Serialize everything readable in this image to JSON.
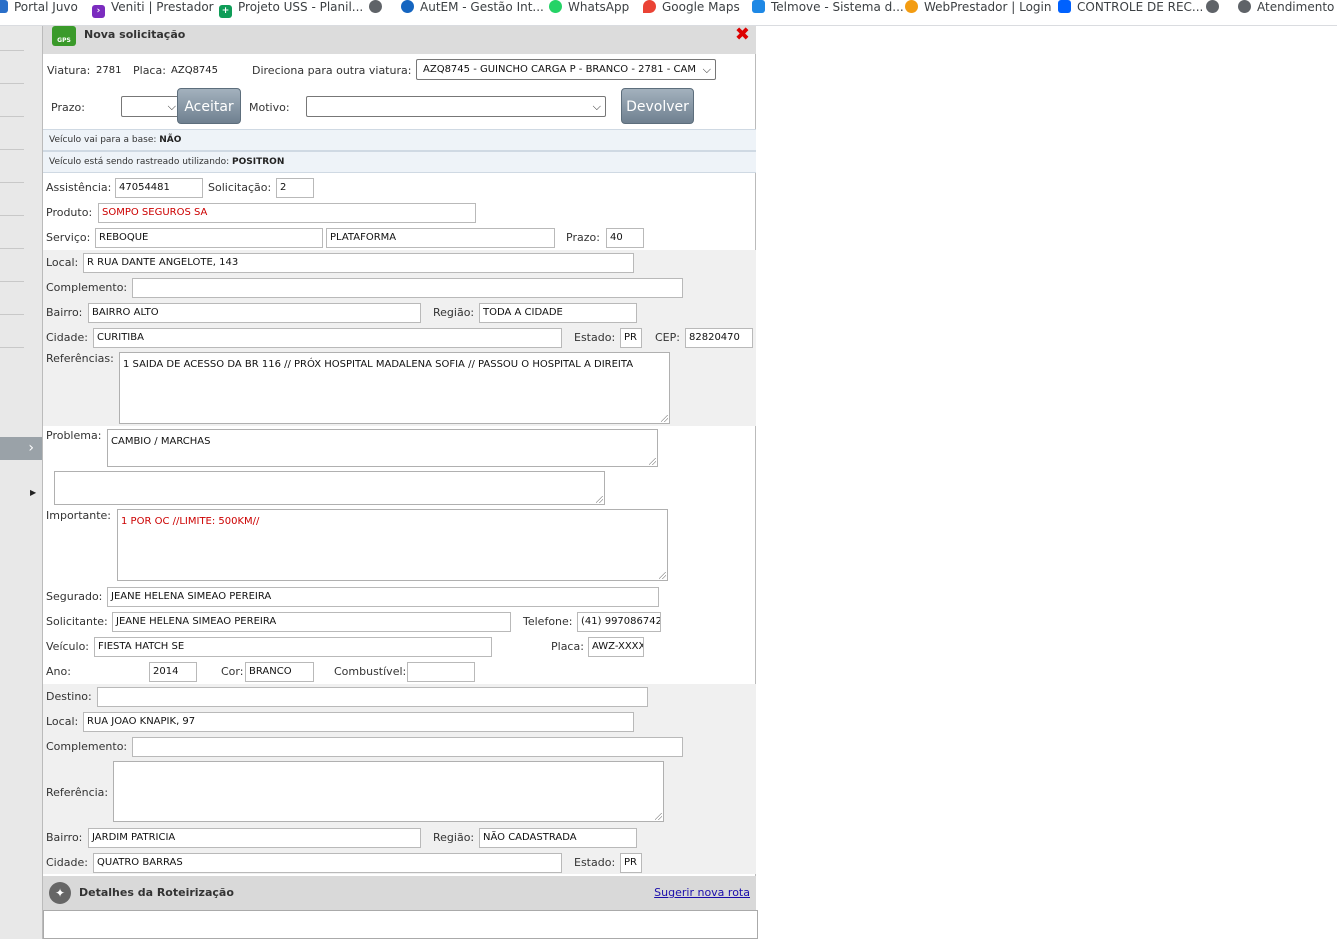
{
  "bookmarks": [
    {
      "label": "Portal Juvo",
      "icon": "portal-icon"
    },
    {
      "label": "Veniti | Prestador",
      "icon": "veniti-icon"
    },
    {
      "label": "Projeto USS - Planil...",
      "icon": "sheets-icon"
    },
    {
      "label": "",
      "icon": "globe-icon"
    },
    {
      "label": "AutEM - Gestão Int...",
      "icon": "autem-icon"
    },
    {
      "label": "WhatsApp",
      "icon": "whatsapp-icon"
    },
    {
      "label": "Google Maps",
      "icon": "maps-icon"
    },
    {
      "label": "Telmove - Sistema d...",
      "icon": "telmove-icon"
    },
    {
      "label": "WebPrestador | Login",
      "icon": "webprestador-icon"
    },
    {
      "label": "CONTROLE DE REC...",
      "icon": "dropbox-icon"
    },
    {
      "label": "",
      "icon": "globe-icon"
    },
    {
      "label": "Atendimento",
      "icon": "globe-icon"
    }
  ],
  "dialog": {
    "title": "Nova solicitação",
    "gps_badge": "GPS",
    "close_glyph": "✖",
    "viatura_label": "Viatura:",
    "viatura_value": "2781",
    "placa_label": "Placa:",
    "placa_value": "AZQ8745",
    "direciona_label": "Direciona para outra viatura:",
    "direciona_value": "AZQ8745 - GUINCHO CARGA P - BRANCO - 2781 - CAM",
    "prazo_label": "Prazo:",
    "prazo_value": "",
    "aceitar_label": "Aceitar",
    "motivo_label": "Motivo:",
    "motivo_value": "",
    "devolver_label": "Devolver",
    "base_info_label": "Veículo vai para a base:",
    "base_info_value": "NÃO",
    "rastreio_label": "Veículo está sendo rastreado utilizando:",
    "rastreio_value": "POSITRON"
  },
  "form": {
    "assistencia_label": "Assistência:",
    "assistencia": "47054481",
    "solicitacao_label": "Solicitação:",
    "solicitacao": "2",
    "produto_label": "Produto:",
    "produto": "SOMPO SEGUROS SA",
    "servico_label": "Serviço:",
    "servico": "REBOQUE",
    "servico_tipo": "PLATAFORMA",
    "prazo_label": "Prazo:",
    "prazo": "40",
    "local_label": "Local:",
    "local": "R RUA DANTE ANGELOTE, 143",
    "complemento_label": "Complemento:",
    "complemento": "",
    "bairro_label": "Bairro:",
    "bairro": "BAIRRO ALTO",
    "regiao_label": "Região:",
    "regiao": "TODA A CIDADE",
    "cidade_label": "Cidade:",
    "cidade": "CURITIBA",
    "estado_label": "Estado:",
    "estado": "PR",
    "cep_label": "CEP:",
    "cep": "82820470",
    "referencias_label": "Referências:",
    "referencias": "1 SAIDA DE ACESSO DA BR 116 // PRÓX HOSPITAL MADALENA SOFIA // PASSOU O HOSPITAL A DIREITA",
    "problema_label": "Problema:",
    "problema": "CAMBIO / MARCHAS",
    "problema_extra": "",
    "importante_label": "Importante:",
    "importante": "1 POR OC  //LIMITE: 500KM//",
    "segurado_label": "Segurado:",
    "segurado": "JEANE HELENA SIMEAO PEREIRA",
    "solicitante_label": "Solicitante:",
    "solicitante": "JEANE HELENA SIMEAO PEREIRA",
    "telefone_label": "Telefone:",
    "telefone": "(41) 997086742",
    "veiculo_label": "Veículo:",
    "veiculo": "FIESTA HATCH SE",
    "placa_label": "Placa:",
    "placa": "AWZ-XXXX",
    "ano_label": "Ano:",
    "ano": "2014",
    "cor_label": "Cor:",
    "cor": "BRANCO",
    "combustivel_label": "Combustível:",
    "combustivel": ""
  },
  "destino": {
    "destino_label": "Destino:",
    "destino": "",
    "local_label": "Local:",
    "local": "RUA JOAO KNAPIK, 97",
    "complemento_label": "Complemento:",
    "complemento": "",
    "referencia_label": "Referência:",
    "referencia": "",
    "bairro_label": "Bairro:",
    "bairro": "JARDIM PATRICIA",
    "regiao_label": "Região:",
    "regiao": "NÃO CADASTRADA",
    "cidade_label": "Cidade:",
    "cidade": "QUATRO BARRAS",
    "estado_label": "Estado:",
    "estado": "PR"
  },
  "roteirizacao": {
    "title": "Detalhes da Roteirização",
    "link": "Sugerir nova rota"
  },
  "rail": {
    "toggle_glyph": "›",
    "arrow_glyph": "▶"
  }
}
